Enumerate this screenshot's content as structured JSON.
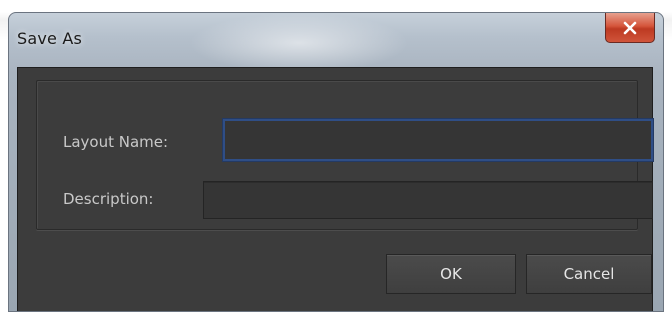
{
  "window": {
    "title": "Save As",
    "close_icon": "close-x-icon"
  },
  "form": {
    "layout_name": {
      "label": "Layout Name:",
      "value": "",
      "placeholder": ""
    },
    "description": {
      "label": "Description:",
      "value": "",
      "placeholder": ""
    }
  },
  "buttons": {
    "ok_label": "OK",
    "cancel_label": "Cancel"
  },
  "colors": {
    "dialog_body": "#3c3c3c",
    "focus_border": "#2f4e86",
    "close_button": "#d5553b",
    "text": "#c9c9c9"
  }
}
